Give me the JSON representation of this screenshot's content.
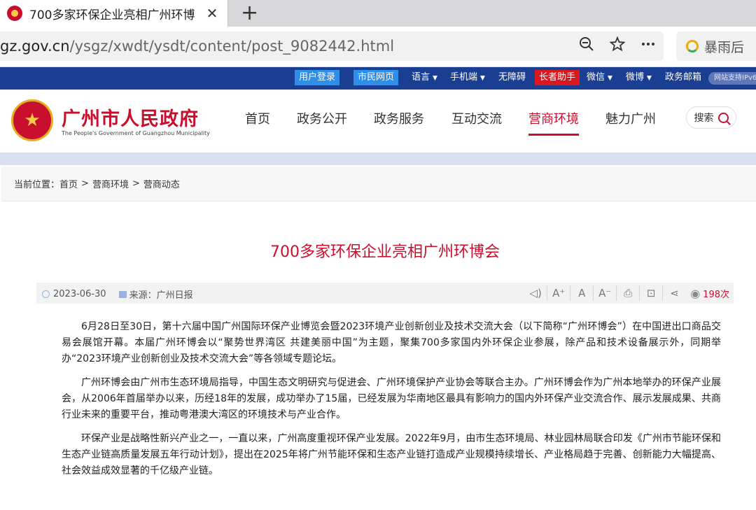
{
  "browser": {
    "tab_title": "700多家环保企业亮相广州环博",
    "new_tab": "+",
    "close": "✕",
    "url_host": "gz.gov.cn",
    "url_path": "/ysgz/xwdt/ysdt/content/post_9082442.html",
    "weather": "暴雨后"
  },
  "topbar": {
    "user_login": "用户登录",
    "citizen_page": "市民网页",
    "language": "语言",
    "mobile": "手机端",
    "accessibility": "无障碍",
    "elder_helper": "长者助手",
    "wechat": "微信",
    "weibo": "微博",
    "gov_email": "政务邮箱",
    "ipv6": "网站支持IPv6"
  },
  "header": {
    "site_name": "广州市人民政府",
    "site_name_en": "The People's Government of Guangzhou Municipality",
    "nav": [
      "首页",
      "政务公开",
      "政务服务",
      "互动交流",
      "营商环境",
      "魅力广州"
    ],
    "active_nav": "营商环境",
    "search_label": "搜索"
  },
  "breadcrumb": {
    "label": "当前位置：",
    "items": [
      "首页",
      "营商环境",
      "营商动态"
    ],
    "separator": ">"
  },
  "article": {
    "title": "700多家环保企业亮相广州环博会",
    "date": "2023-06-30",
    "source_label": "来源：",
    "source": "广州日报",
    "views": "198次",
    "paragraphs": [
      "6月28日至30日，第十六届中国广州国际环保产业博览会暨2023环境产业创新创业及技术交流大会（以下简称“广州环博会”）在中国进出口商品交易会展馆开幕。本届广州环博会以“聚势世界湾区 共建美丽中国”为主题，聚集700多家国内外环保企业参展，除产品和技术设备展示外，同期举办“2023环境产业创新创业及技术交流大会”等各领域专题论坛。",
      "广州环博会由广州市生态环境局指导，中国生态文明研究与促进会、广州环境保护产业协会等联合主办。广州环博会作为广州本地举办的环保产业展会，从2006年首届举办以来，历经18年的发展，成功举办了15届，已经发展为华南地区最具有影响力的国内外环保产业交流合作、展示发展成果、共商行业未来的重要平台，推动粤港澳大湾区的环境技术与产业合作。",
      "环保产业是战略性新兴产业之一，一直以来，广州高度重视环保产业发展。2022年9月，由市生态环境局、林业园林局联合印发《广州市节能环保和生态产业链高质量发展五年行动计划》，提出在2025年将广州节能环保和生态产业链打造成产业规模持续增长、产业格局趋于完善、创新能力大幅提高、社会效益成效显著的千亿级产业链。"
    ]
  },
  "colors": {
    "brand_red": "#c8102e",
    "topbar_blue": "#1a3e91",
    "button_blue": "#2f8ee8"
  }
}
